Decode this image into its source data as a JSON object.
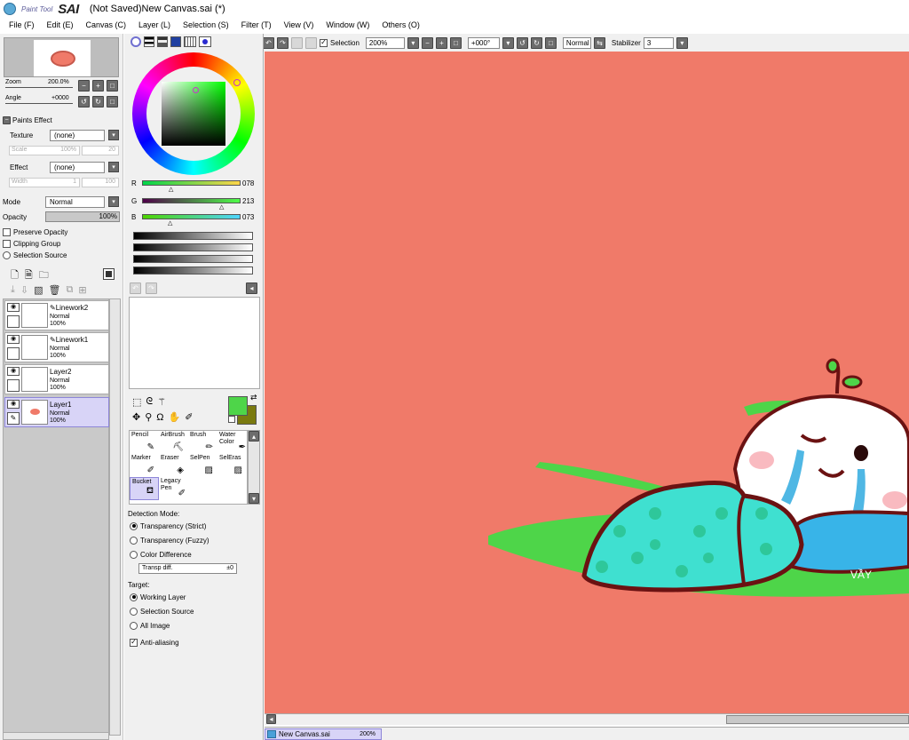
{
  "titlebar": {
    "logo_small": "Paint Tool",
    "logo_big": "SAI",
    "title": "(Not Saved)New Canvas.sai (*)"
  },
  "menu": [
    "File (F)",
    "Edit (E)",
    "Canvas (C)",
    "Layer (L)",
    "Selection (S)",
    "Filter (T)",
    "View (V)",
    "Window (W)",
    "Others (O)"
  ],
  "toolbar": {
    "selection_label": "Selection",
    "zoom_value": "200%",
    "angle_value": "+000°",
    "mode_value": "Normal",
    "stabilizer_label": "Stabilizer",
    "stabilizer_value": "3"
  },
  "navigator": {
    "zoom_label": "Zoom",
    "zoom_value": "200.0%",
    "angle_label": "Angle",
    "angle_value": "+0000"
  },
  "paint_effects": {
    "header": "Paints Effect",
    "texture_label": "Texture",
    "texture_value": "(none)",
    "scale_label": "Scale",
    "scale_value": "100%",
    "scale_num": "20",
    "effect_label": "Effect",
    "effect_value": "(none)",
    "width_label": "Width",
    "width_value": "1",
    "width_num": "100"
  },
  "layer_props": {
    "mode_label": "Mode",
    "mode_value": "Normal",
    "opacity_label": "Opacity",
    "opacity_value": "100%",
    "preserve_opacity": "Preserve Opacity",
    "clipping_group": "Clipping Group",
    "selection_source": "Selection Source"
  },
  "layers": [
    {
      "name": "Linework2",
      "mode": "Normal",
      "opacity": "100%",
      "pen": true,
      "selected": false
    },
    {
      "name": "Linework1",
      "mode": "Normal",
      "opacity": "100%",
      "pen": true,
      "selected": false
    },
    {
      "name": "Layer2",
      "mode": "Normal",
      "opacity": "100%",
      "pen": false,
      "selected": false
    },
    {
      "name": "Layer1",
      "mode": "Normal",
      "opacity": "100%",
      "pen": false,
      "selected": true
    }
  ],
  "color": {
    "r_label": "R",
    "r_value": "078",
    "g_label": "G",
    "g_value": "213",
    "b_label": "B",
    "b_value": "073",
    "primary": "#4ed549",
    "secondary": "#7a7a10"
  },
  "tools": [
    {
      "label": "Pencil"
    },
    {
      "label": "AirBrush"
    },
    {
      "label": "Brush"
    },
    {
      "label": "Water Color"
    },
    {
      "label": "Marker"
    },
    {
      "label": "Eraser"
    },
    {
      "label": "SelPen"
    },
    {
      "label": "SelEras"
    },
    {
      "label": "Bucket"
    },
    {
      "label": "Legacy Pen"
    }
  ],
  "bucket_options": {
    "detection_label": "Detection Mode:",
    "det_options": [
      "Transparency (Strict)",
      "Transparency (Fuzzy)",
      "Color Difference"
    ],
    "transp_diff_label": "Transp diff.",
    "transp_diff_value": "±0",
    "target_label": "Target:",
    "target_options": [
      "Working Layer",
      "Selection Source",
      "All Image"
    ],
    "antialias_label": "Anti-aliasing"
  },
  "canvas": {
    "background": "#f07a69",
    "signature": "VẦY"
  },
  "taskbar": {
    "tab_label": "New Canvas.sai",
    "tab_zoom": "200%"
  }
}
